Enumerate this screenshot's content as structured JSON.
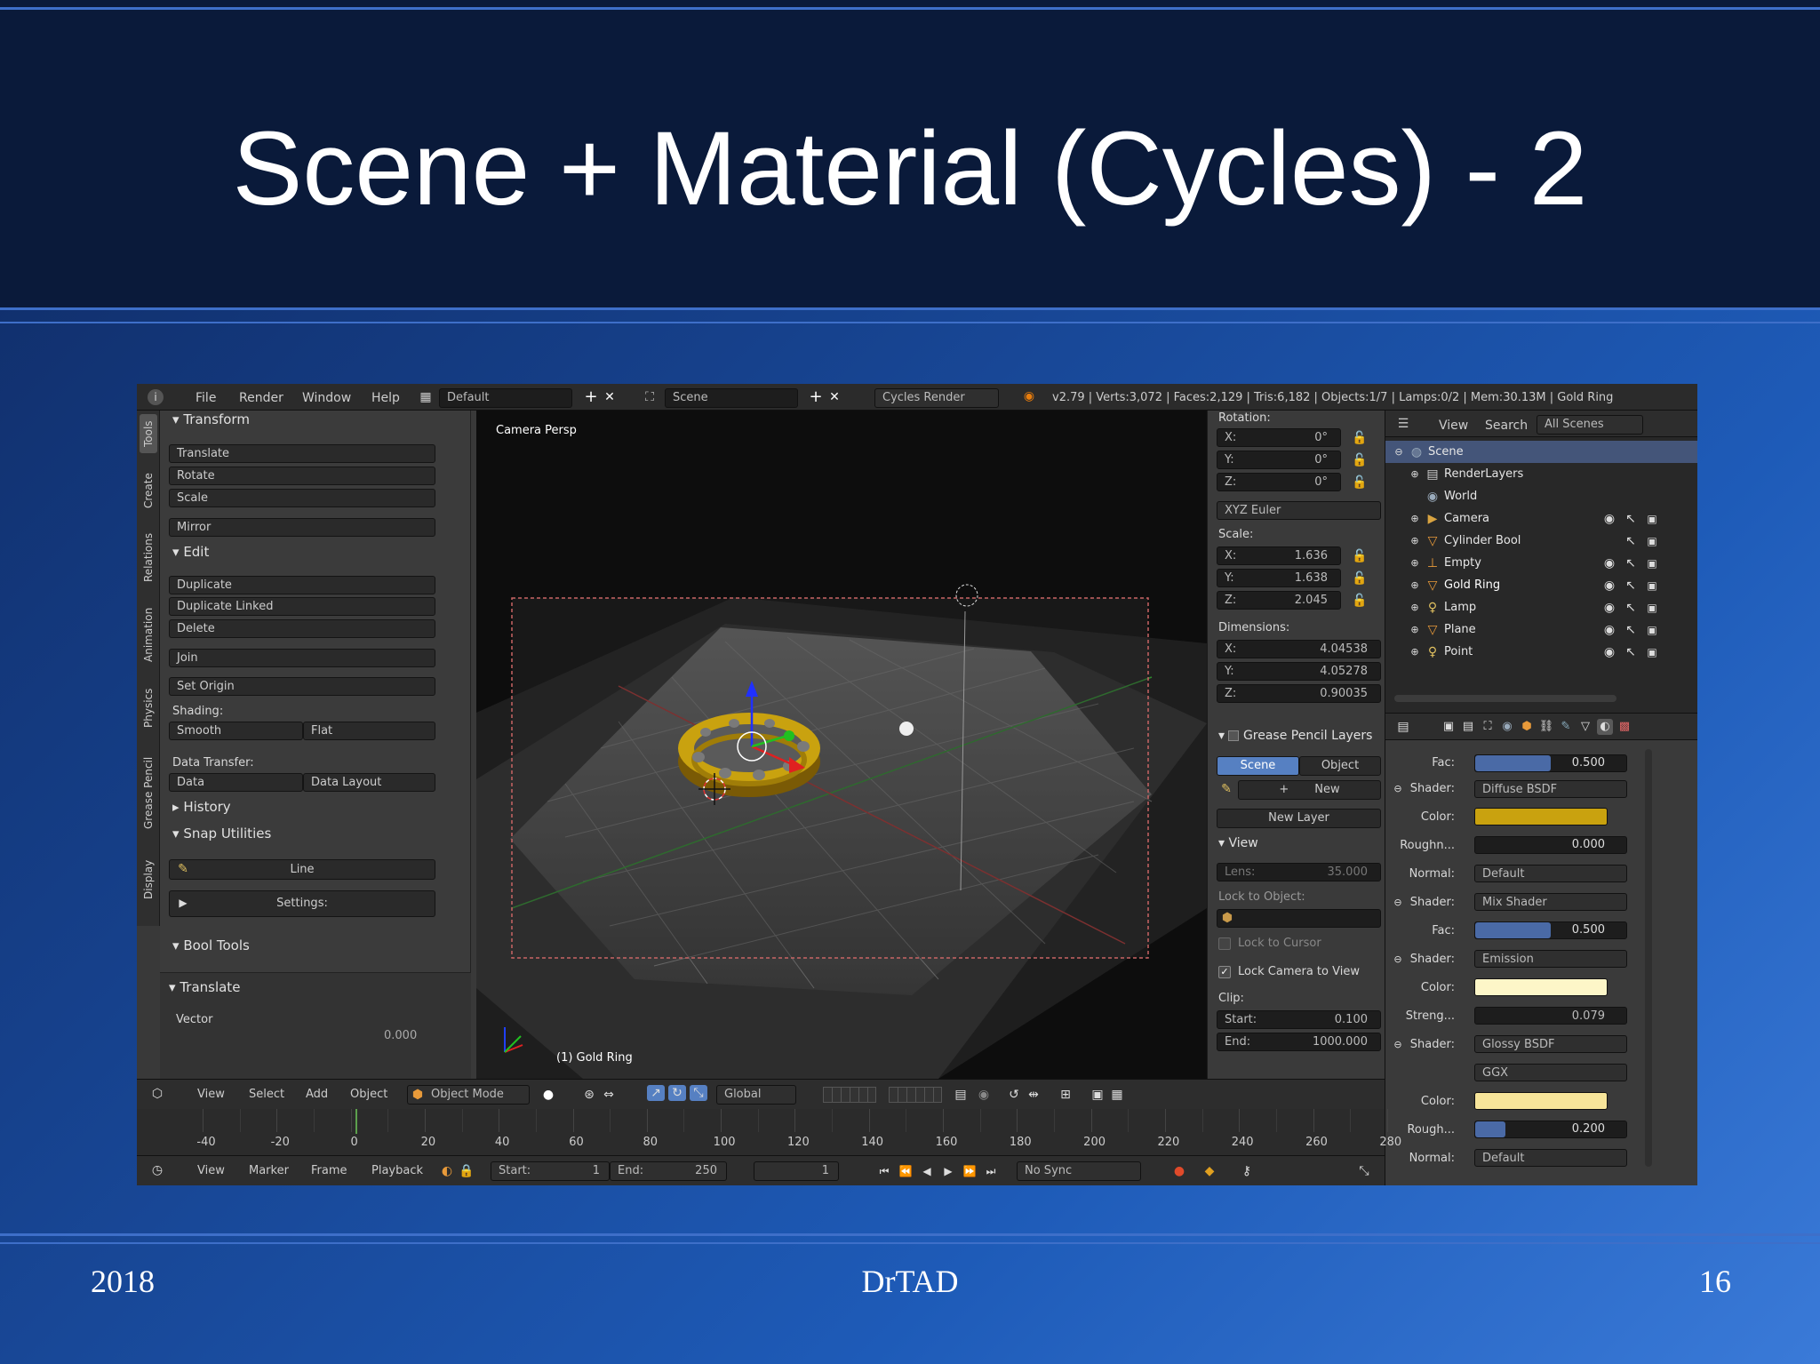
{
  "slide": {
    "title": "Scene + Material (Cycles) - 2",
    "footer_year": "2018",
    "footer_author": "DrTAD",
    "footer_page": "16"
  },
  "infobar": {
    "menus": [
      "File",
      "Render",
      "Window",
      "Help"
    ],
    "layout": "Default",
    "scene": "Scene",
    "engine": "Cycles Render",
    "stats": "v2.79 | Verts:3,072 | Faces:2,129 | Tris:6,182 | Objects:1/7 | Lamps:0/2 | Mem:30.13M | Gold Ring"
  },
  "tool_tabs": [
    "Tools",
    "Create",
    "Relations",
    "Animation",
    "Physics",
    "Grease Pencil",
    "Display"
  ],
  "toolshelf": {
    "transform_header": "Transform",
    "transform_buttons": [
      "Translate",
      "Rotate",
      "Scale"
    ],
    "mirror": "Mirror",
    "edit_header": "Edit",
    "edit_buttons": [
      "Duplicate",
      "Duplicate Linked",
      "Delete"
    ],
    "join": "Join",
    "set_origin": "Set Origin",
    "shading_label": "Shading:",
    "smooth": "Smooth",
    "flat": "Flat",
    "data_transfer_label": "Data Transfer:",
    "data": "Data",
    "data_layout": "Data Layout",
    "history": "History",
    "snap_utilities": "Snap Utilities",
    "line": "Line",
    "settings": "Settings:",
    "bool_tools": "Bool Tools",
    "operator_header": "Translate",
    "vector_label": "Vector",
    "vector_x_value": "0.000"
  },
  "viewport": {
    "view_name": "Camera Persp",
    "object_label": "(1) Gold Ring"
  },
  "properties_panel": {
    "rotation_label": "Rotation:",
    "rotation": [
      {
        "axis": "X:",
        "value": "0°"
      },
      {
        "axis": "Y:",
        "value": "0°"
      },
      {
        "axis": "Z:",
        "value": "0°"
      }
    ],
    "rotation_mode": "XYZ Euler",
    "scale_label": "Scale:",
    "scale": [
      {
        "axis": "X:",
        "value": "1.636"
      },
      {
        "axis": "Y:",
        "value": "1.638"
      },
      {
        "axis": "Z:",
        "value": "2.045"
      }
    ],
    "dimensions_label": "Dimensions:",
    "dimensions": [
      {
        "axis": "X:",
        "value": "4.04538"
      },
      {
        "axis": "Y:",
        "value": "4.05278"
      },
      {
        "axis": "Z:",
        "value": "0.90035"
      }
    ],
    "grease_pencil_layers": "Grease Pencil Layers",
    "gp_scene_tab": "Scene",
    "gp_object_tab": "Object",
    "gp_new": "New",
    "gp_new_layer": "New Layer",
    "view_header": "View",
    "lens_label": "Lens:",
    "lens_value": "35.000",
    "lock_to_object": "Lock to Object:",
    "lock_to_cursor": "Lock to Cursor",
    "lock_camera_to_view": "Lock Camera to View",
    "clip_label": "Clip:",
    "clip_start_label": "Start:",
    "clip_start_value": "0.100",
    "clip_end_label": "End:",
    "clip_end_value": "1000.000"
  },
  "outliner": {
    "menu_view": "View",
    "menu_search": "Search",
    "scene_filter": "All Scenes",
    "items": [
      "Scene",
      "RenderLayers",
      "World",
      "Camera",
      "Cylinder Bool",
      "Empty",
      "Gold Ring",
      "Lamp",
      "Plane",
      "Point"
    ]
  },
  "material": {
    "fac1_label": "Fac:",
    "fac1_value": "0.500",
    "fac1_fraction": 0.5,
    "shader1_label": "Shader:",
    "shader1_value": "Diffuse BSDF",
    "color1_label": "Color:",
    "color1_hex": "#c9a20f",
    "rough1_label": "Roughn...",
    "rough1_value": "0.000",
    "rough1_fraction": 0.0,
    "normal1_label": "Normal:",
    "normal1_value": "Default",
    "shader2_label": "Shader:",
    "shader2_value": "Mix Shader",
    "fac2_label": "Fac:",
    "fac2_value": "0.500",
    "fac2_fraction": 0.5,
    "shader3_label": "Shader:",
    "shader3_value": "Emission",
    "color3_label": "Color:",
    "color3_hex": "#fdf6c8",
    "strength_label": "Streng...",
    "strength_value": "0.079",
    "shader4_label": "Shader:",
    "shader4_value": "Glossy BSDF",
    "distribution_value": "GGX",
    "color4_label": "Color:",
    "color4_hex": "#f7e59a",
    "rough4_label": "Rough...",
    "rough4_value": "0.200",
    "rough4_fraction": 0.2,
    "normal4_label": "Normal:",
    "normal4_value": "Default"
  },
  "v3d_header": {
    "menus": [
      "View",
      "Select",
      "Add",
      "Object"
    ],
    "mode": "Object Mode",
    "orientation": "Global"
  },
  "timeline": {
    "ticks": [
      "-40",
      "-20",
      "0",
      "20",
      "40",
      "60",
      "80",
      "100",
      "120",
      "140",
      "160",
      "180",
      "200",
      "220",
      "240",
      "260",
      "280"
    ],
    "menus": [
      "View",
      "Marker",
      "Frame",
      "Playback"
    ],
    "start_label": "Start:",
    "start_value": "1",
    "end_label": "End:",
    "end_value": "250",
    "current_frame": "1",
    "sync": "No Sync"
  }
}
